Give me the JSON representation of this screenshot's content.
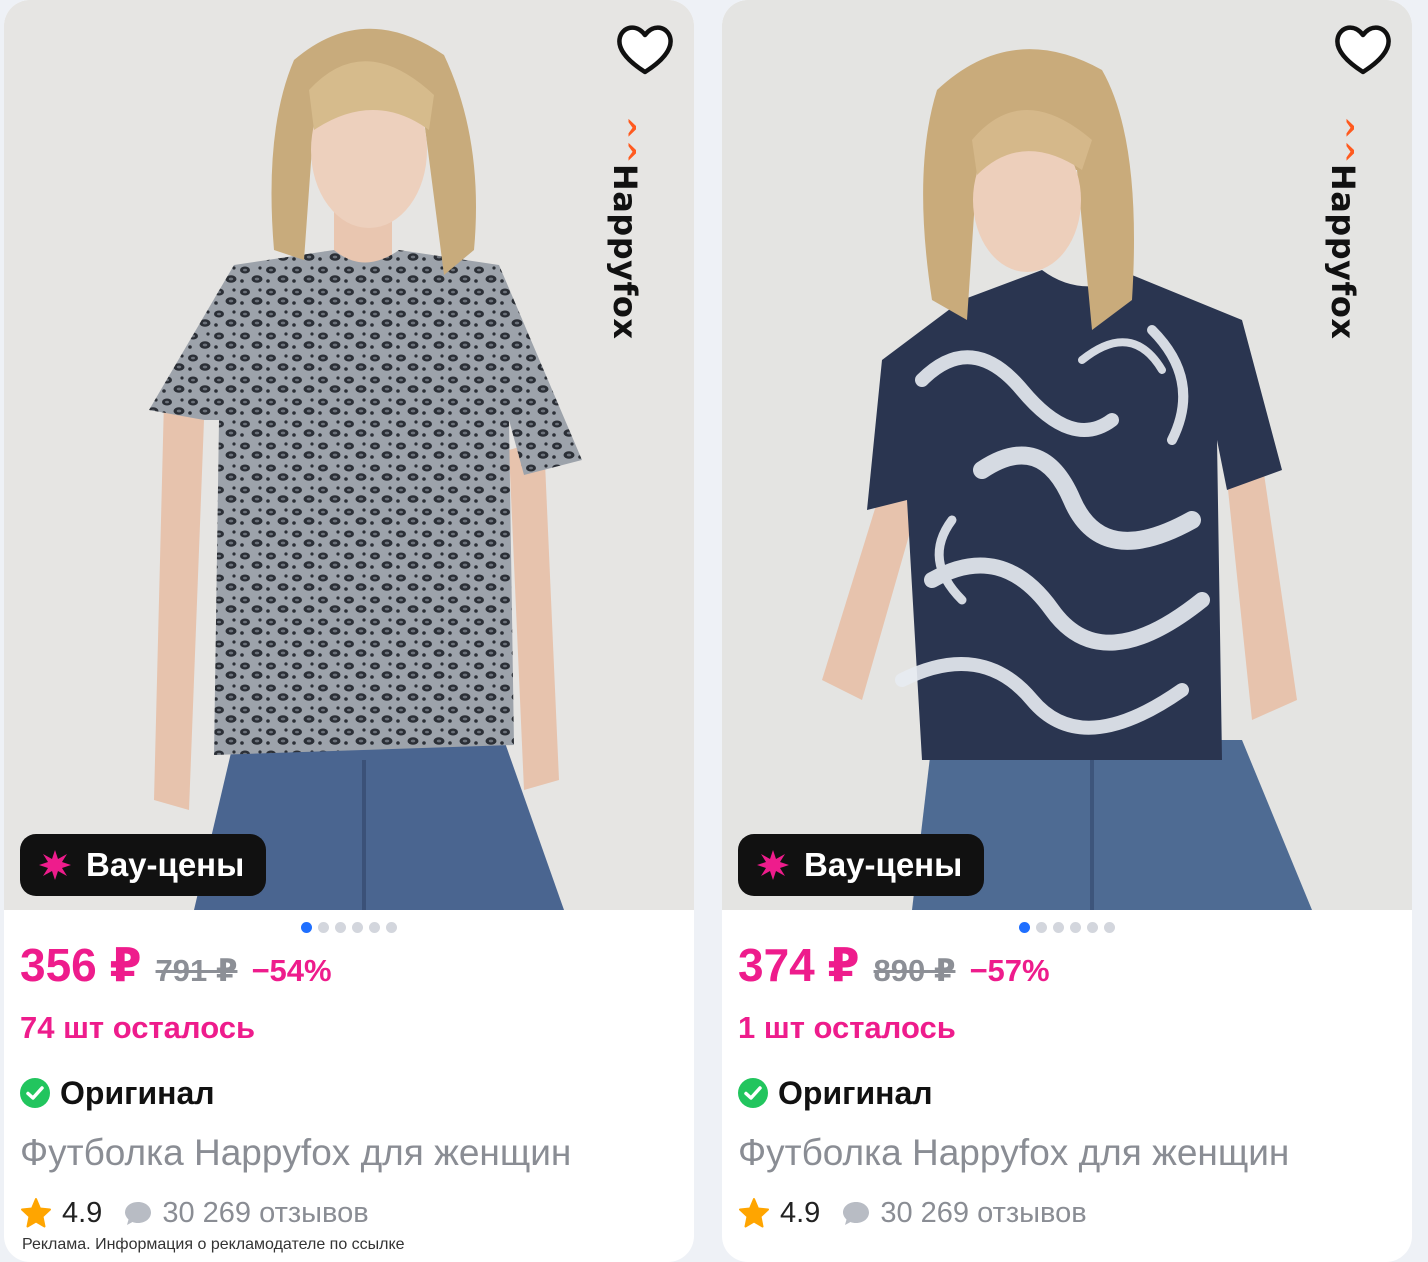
{
  "cards": [
    {
      "brand": "Happyfox",
      "badge": "Вау-цены",
      "price": "356 ₽",
      "old_price": "791 ₽",
      "discount": "−54%",
      "stock": "74 шт осталось",
      "original_label": "Оригинал",
      "title": "Футболка Happyfox для женщин",
      "rating": "4.9",
      "reviews": "30 269 отзывов",
      "ad_note": "Реклама. Информация о рекламодателе по ссылке",
      "image_slides": 6,
      "active_slide": 1,
      "shirt_print": "leopard"
    },
    {
      "brand": "Happyfox",
      "badge": "Вау-цены",
      "price": "374 ₽",
      "old_price": "890 ₽",
      "discount": "−57%",
      "stock": "1 шт осталось",
      "original_label": "Оригинал",
      "title": "Футболка Happyfox для женщин",
      "rating": "4.9",
      "reviews": "30 269 отзывов",
      "image_slides": 6,
      "active_slide": 1,
      "shirt_print": "smoke"
    }
  ],
  "icons": {
    "favorite": "heart-outline-icon",
    "badge": "pink-star-burst-icon",
    "original": "green-check-circle-icon",
    "rating": "orange-star-icon",
    "reviews": "speech-bubble-icon"
  },
  "colors": {
    "accent_pink": "#ee1c8c",
    "badge_bg": "#111111",
    "check_green": "#22c55e",
    "star_orange": "#ffa500",
    "dot_active": "#1f6fff"
  }
}
